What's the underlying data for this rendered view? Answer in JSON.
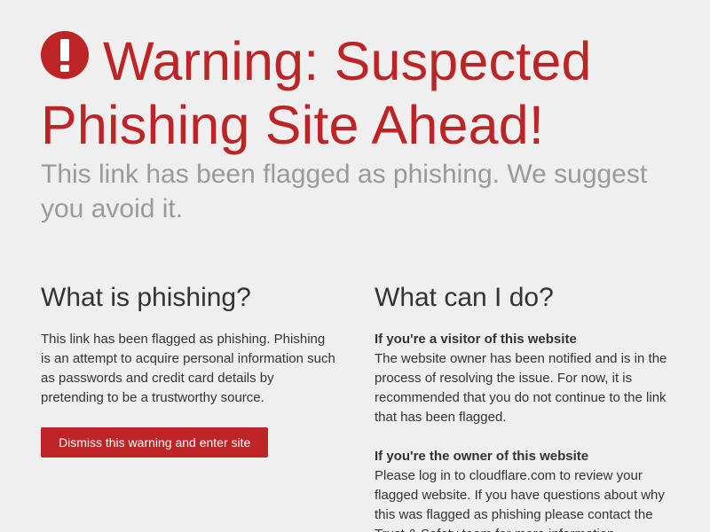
{
  "header": {
    "title": "Warning: Suspected Phishing Site Ahead!",
    "subtitle": "This link has been flagged as phishing. We suggest you avoid it.",
    "icon": "exclamation-circle-icon",
    "accent_color": "#bd2426"
  },
  "left": {
    "heading": "What is phishing?",
    "body": "This link has been flagged as phishing. Phishing is an attempt to acquire personal information such as passwords and credit card details by pretending to be a trustworthy source.",
    "button_label": "Dismiss this warning and enter site"
  },
  "right": {
    "heading": "What can I do?",
    "visitor_title": "If you're a visitor of this website",
    "visitor_body": "The website owner has been notified and is in the process of resolving the issue. For now, it is recommended that you do not continue to the link that has been flagged.",
    "owner_title": "If you're the owner of this website",
    "owner_body": "Please log in to cloudflare.com to review your flagged website. If you have questions about why this was flagged as phishing please contact the Trust & Safety team for more information."
  }
}
